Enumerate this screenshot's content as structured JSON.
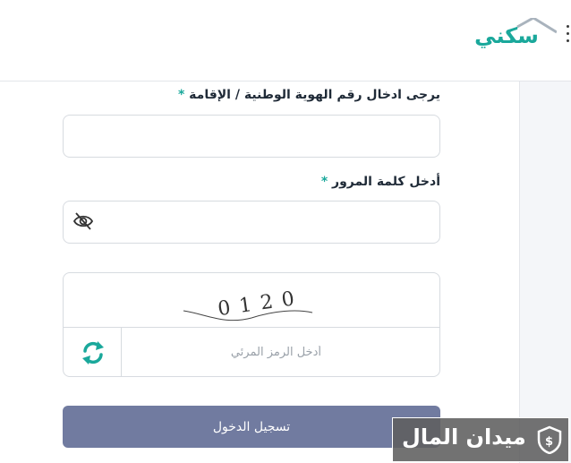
{
  "header": {
    "logo_text": "سكني"
  },
  "form": {
    "id_label": "يرجى ادخال رقم الهوية الوطنية / الإقامة",
    "id_required": "*",
    "id_value": "",
    "password_label": "أدخل كلمة المرور",
    "password_required": "*",
    "password_value": "",
    "captcha_code": "0120",
    "captcha_placeholder": "أدخل الرمز المرئي",
    "login_label": "تسجيل الدخول"
  },
  "watermark": {
    "text": "ميدان المال"
  },
  "icons": {
    "menu": "menu-dots-icon",
    "password_toggle": "eye-slash-icon",
    "captcha_refresh": "refresh-icon",
    "watermark": "shield-dollar-icon"
  },
  "colors": {
    "accent": "#1aa89b",
    "button": "#717ba0",
    "border": "#d7dbe0"
  }
}
